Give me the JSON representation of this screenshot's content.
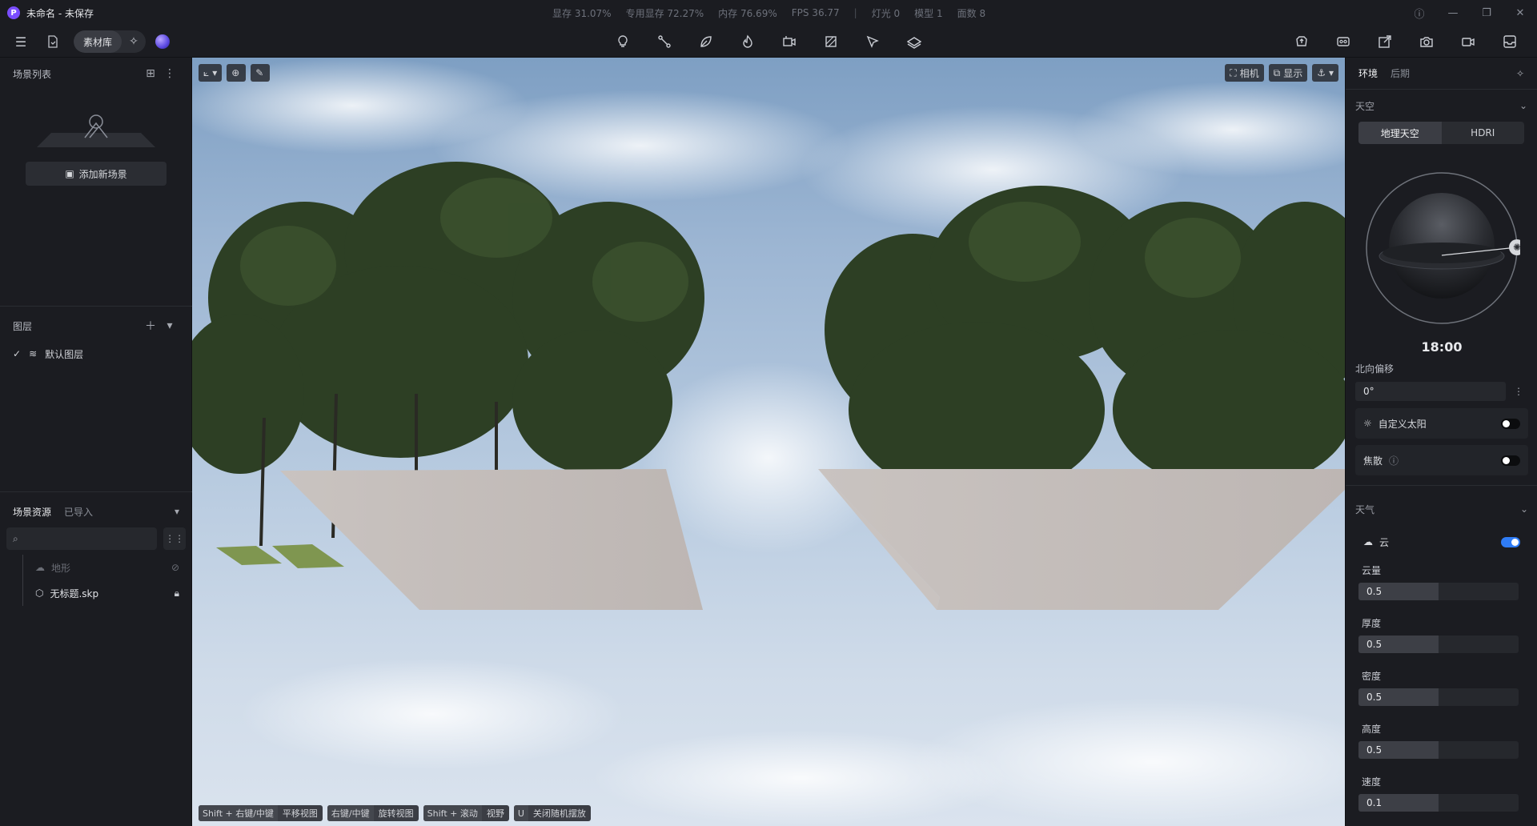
{
  "window": {
    "title": "未命名 - 未保存",
    "stats": [
      "显存 31.07%",
      "专用显存 72.27%",
      "内存 76.69%",
      "FPS 36.77"
    ],
    "counts": [
      "灯光 0",
      "模型 1",
      "面数 8"
    ]
  },
  "toolbar": {
    "library_label": "素材库"
  },
  "left": {
    "scenes_title": "场景列表",
    "add_scene_label": "添加新场景",
    "layers_title": "图层",
    "layers": [
      {
        "label": "默认图层",
        "checked": true
      }
    ],
    "assets_tab_active": "场景资源",
    "assets_tab_other": "已导入",
    "search_placeholder": "",
    "tree": [
      {
        "label": "地形",
        "hidden": true
      },
      {
        "label": "无标题.skp",
        "locked": true
      }
    ]
  },
  "viewport": {
    "camera_label": "相机",
    "display_label": "显示",
    "hints": [
      {
        "key": "Shift + 右键/中键",
        "action": "平移视图"
      },
      {
        "key": "右键/中键",
        "action": "旋转视图"
      },
      {
        "key": "Shift + 滚动",
        "action": "视野"
      },
      {
        "key": "U",
        "action": "关闭随机摆放"
      }
    ]
  },
  "right": {
    "tab_active": "环境",
    "tab_other": "后期",
    "sky_section": "天空",
    "sky_mode_a": "地理天空",
    "sky_mode_b": "HDRI",
    "time": "18:00",
    "north_offset_label": "北向偏移",
    "north_offset_value": "0°",
    "custom_sun_label": "自定义太阳",
    "custom_sun_on": false,
    "caustics_label": "焦散",
    "caustics_on": false,
    "weather_section": "天气",
    "cloud_label": "云",
    "cloud_on": true,
    "sliders": [
      {
        "label": "云量",
        "value": "0.5",
        "fraction": 0.5
      },
      {
        "label": "厚度",
        "value": "0.5",
        "fraction": 0.5
      },
      {
        "label": "密度",
        "value": "0.5",
        "fraction": 0.5
      },
      {
        "label": "高度",
        "value": "0.5",
        "fraction": 0.5
      },
      {
        "label": "速度",
        "value": "0.1",
        "fraction": 0.5
      }
    ],
    "colors": {
      "accent": "#2f7cf6"
    }
  }
}
